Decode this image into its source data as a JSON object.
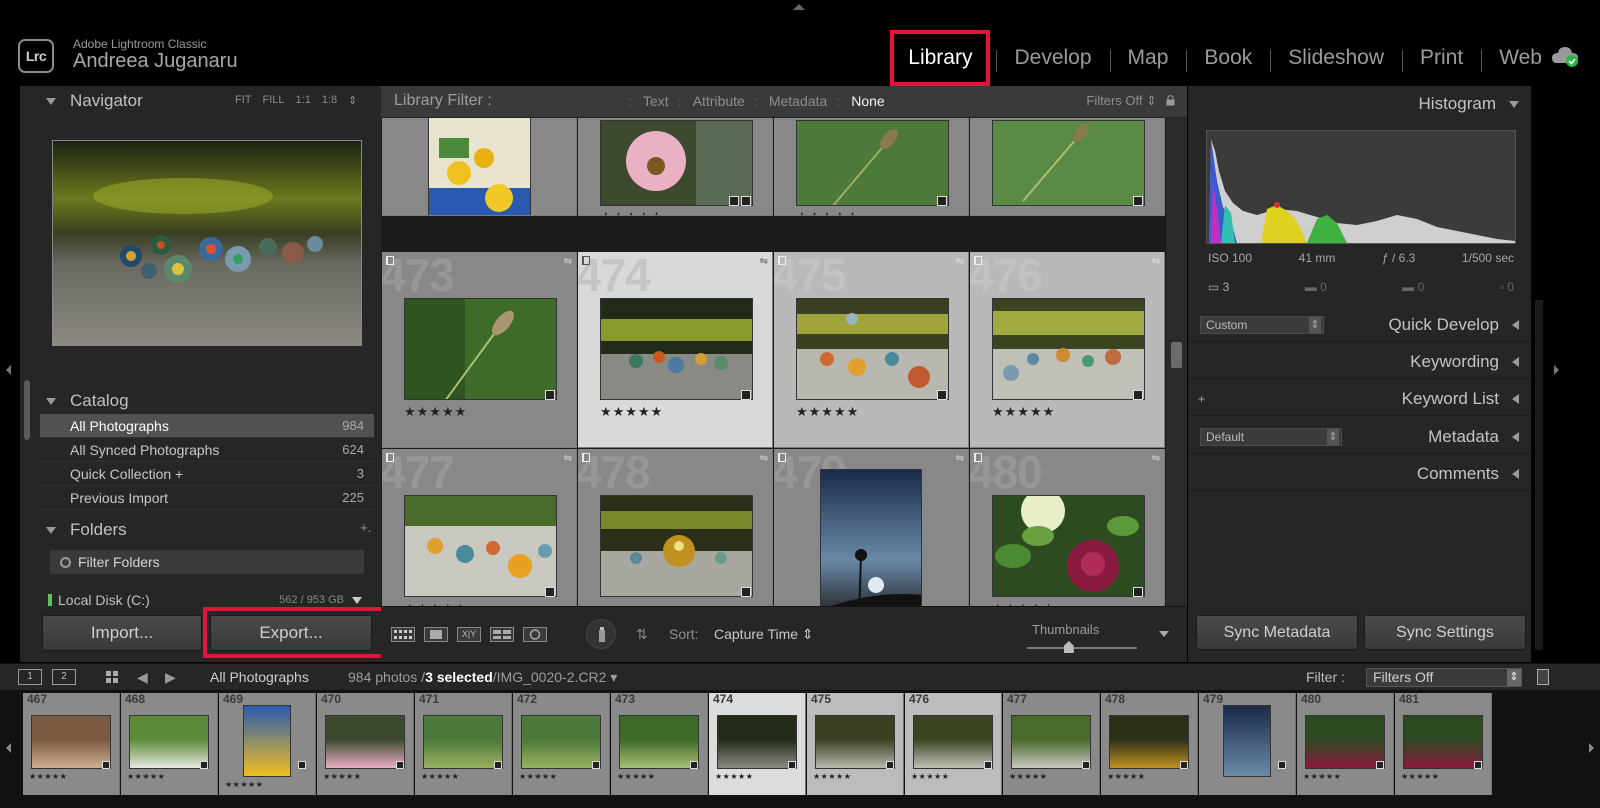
{
  "header": {
    "logo": "Lrc",
    "app_name": "Adobe Lightroom Classic",
    "user_name": "Andreea Juganaru",
    "modules": [
      "Library",
      "Develop",
      "Map",
      "Book",
      "Slideshow",
      "Print",
      "Web"
    ],
    "active_module": "Library",
    "cloud_icon": "cloud-sync-icon"
  },
  "navigator": {
    "title": "Navigator",
    "zoom_options": [
      "FIT",
      "FILL",
      "1:1",
      "1:8"
    ],
    "zoom_menu": "⇕"
  },
  "catalog": {
    "title": "Catalog",
    "items": [
      {
        "label": "All Photographs",
        "count": "984",
        "selected": true
      },
      {
        "label": "All Synced Photographs",
        "count": "624"
      },
      {
        "label": "Quick Collection +",
        "count": "3"
      },
      {
        "label": "Previous Import",
        "count": "225"
      }
    ]
  },
  "folders": {
    "title": "Folders",
    "add_symbol": "+.",
    "filter_placeholder": "Filter Folders",
    "disk_label": "Local Disk (C:)",
    "disk_size": "562 / 953 GB"
  },
  "left_buttons": {
    "import": "Import...",
    "export": "Export..."
  },
  "library_filter": {
    "title": "Library Filter :",
    "tabs": [
      "Text",
      "Attribute",
      "Metadata",
      "None"
    ],
    "active_tab": "None",
    "filters_off": "Filters Off ⇕"
  },
  "grid": {
    "rows": [
      {
        "numbers": [
          "",
          "",
          "",
          ""
        ],
        "stars": [
          "★★★★★",
          "★★★★★",
          "★★★★★",
          ""
        ]
      },
      {
        "numbers": [
          "473",
          "474",
          "475",
          "476"
        ],
        "stars": [
          "★★★★★",
          "★★★★★",
          "★★★★★",
          "★★★★★"
        ]
      },
      {
        "numbers": [
          "477",
          "478",
          "479",
          "480"
        ],
        "stars": [
          "★★★★★",
          "",
          "",
          "★★★★★"
        ]
      }
    ]
  },
  "toolbar": {
    "sort_label": "Sort:",
    "sort_value": "Capture Time ⇕",
    "thumbnails_label": "Thumbnails",
    "thumbnails_level": 0.38
  },
  "right_panel": {
    "histogram_title": "Histogram",
    "exif": [
      "ISO 100",
      "41 mm",
      "ƒ / 6.3",
      "1/500 sec"
    ],
    "tools": [
      "3",
      "0",
      "0",
      "0"
    ],
    "quick_develop": {
      "preset": "Custom",
      "title": "Quick Develop"
    },
    "keywording": "Keywording",
    "keyword_list": {
      "plus": "+",
      "title": "Keyword List"
    },
    "metadata": {
      "preset": "Default",
      "title": "Metadata"
    },
    "comments": "Comments",
    "sync_metadata": "Sync Metadata",
    "sync_settings": "Sync Settings"
  },
  "filmstrip_bar": {
    "screen1": "1",
    "screen2": "2",
    "source": "All Photographs",
    "photo_count": "984 photos /",
    "selected": "3 selected",
    "file": "/IMG_0020-2.CR2 ▾",
    "filter_label": "Filter :",
    "filter_value": "Filters Off"
  },
  "filmstrip": {
    "numbers": [
      "467",
      "468",
      "469",
      "470",
      "471",
      "472",
      "473",
      "474",
      "475",
      "476",
      "477",
      "478",
      "479",
      "480",
      "481"
    ],
    "stars": [
      "★★★★★",
      "★★★★★",
      "★★★★★",
      "★★★★★",
      "★★★★★",
      "★★★★★",
      "★★★★★",
      "★★★★★",
      "★★★★★",
      "★★★★★",
      "★★★★★",
      "★★★★★",
      "",
      "★★★★★",
      "★★★★★"
    ]
  },
  "colors": {
    "highlight": "#e5133a",
    "panel": "#262626",
    "cell": "#888888",
    "cell_selected": "#d9d9d9"
  }
}
